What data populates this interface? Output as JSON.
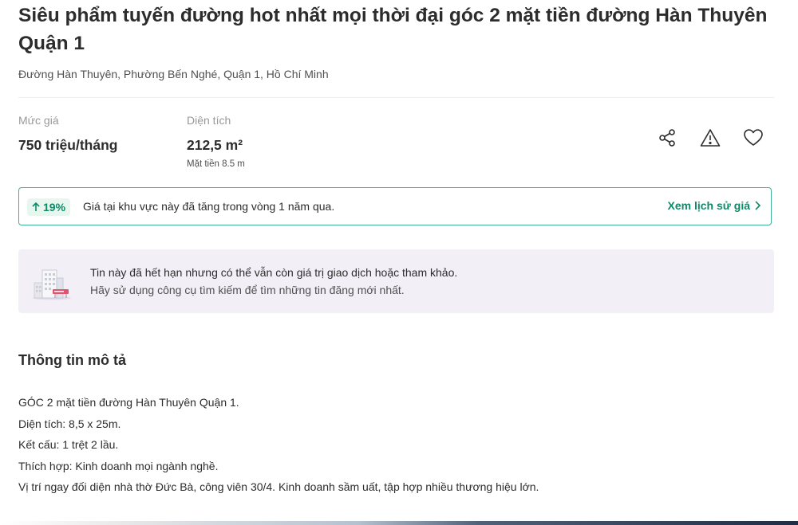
{
  "listing": {
    "title": "Siêu phẩm tuyến đường hot nhất mọi thời đại góc 2 mặt tiền đường Hàn Thuyên Quận 1",
    "address": "Đường Hàn Thuyên, Phường Bến Nghé, Quận 1, Hồ Chí Minh"
  },
  "stats": {
    "price_label": "Mức giá",
    "price_value": "750 triệu/tháng",
    "area_label": "Diện tích",
    "area_value": "212,5 m²",
    "frontage": "Mặt tiền 8.5 m"
  },
  "actions": {
    "icons": [
      "share-icon",
      "warning-icon",
      "heart-icon"
    ]
  },
  "price_trend": {
    "badge": "19%",
    "text": "Giá tại khu vực này đã tăng trong vòng 1 năm qua.",
    "link": "Xem lịch sử giá",
    "color": "#0f8a67"
  },
  "expired_notice": {
    "line1": "Tin này đã hết hạn nhưng có thể vẫn còn giá trị giao dịch hoặc tham khảo.",
    "line2": "Hãy sử dụng công cụ tìm kiếm để tìm những tin đăng mới nhất.",
    "background": "#f3eff7"
  },
  "description": {
    "title": "Thông tin mô tả",
    "lines": [
      "GÓC 2 mặt tiền đường Hàn Thuyên Quận 1.",
      "Diện tích: 8,5 x 25m.",
      "Kết cấu: 1 trệt 2 lầu.",
      "Thích hợp: Kinh doanh mọi ngành nghề.",
      "Vị trí ngay đối diện nhà thờ Đức Bà, công viên 30/4. Kinh doanh sầm uất, tập hợp nhiều thương hiệu lớn."
    ]
  }
}
